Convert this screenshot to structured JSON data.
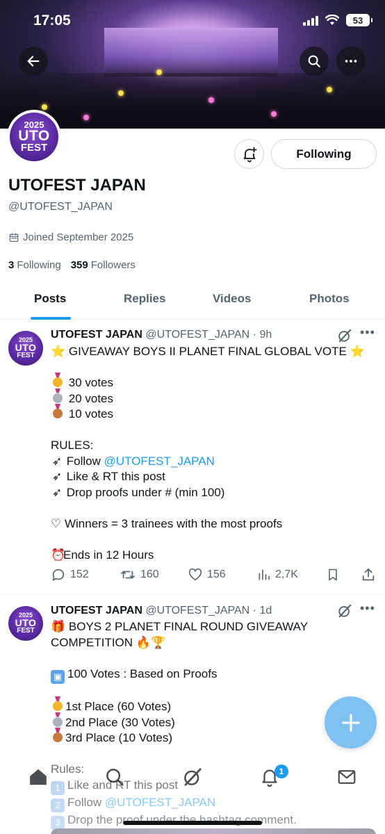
{
  "status_bar": {
    "time": "17:05",
    "battery": "53"
  },
  "profile": {
    "avatar_text": {
      "year": "2025",
      "line1": "UTO",
      "line2": "FEST"
    },
    "following_button": "Following",
    "display_name": "UTOFEST JAPAN",
    "handle": "@UTOFEST_JAPAN",
    "joined": "Joined September 2025",
    "following_count": "3",
    "following_label": "Following",
    "followers_count": "359",
    "followers_label": "Followers"
  },
  "tabs": [
    "Posts",
    "Replies",
    "Videos",
    "Photos"
  ],
  "posts": [
    {
      "name": "UTOFEST JAPAN",
      "handle_time": "@UTOFEST_JAPAN · 9h",
      "title": "GIVEAWAY BOYS II PLANET FINAL GLOBAL VOTE",
      "prizes": [
        "30 votes",
        "20 votes",
        "10 votes"
      ],
      "rules_heading": "RULES:",
      "rule1_prefix": "Follow ",
      "rule1_link": "@UTOFEST_JAPAN",
      "rule2": "Like & RT this post",
      "rule3": "Drop proofs under # (min 100)",
      "winners": "♡ Winners = 3 trainees with the most proofs",
      "ends": "Ends in 12 Hours",
      "stats": {
        "replies": "152",
        "reposts": "160",
        "likes": "156",
        "views": "2,7K"
      }
    },
    {
      "name": "UTOFEST JAPAN",
      "handle_time": "@UTOFEST_JAPAN · 1d",
      "title_line1": "BOYS 2 PLANET FINAL ROUND GIVEAWAY",
      "title_line2": "COMPETITION",
      "votes_line": "100 Votes : Based on Proofs",
      "places": [
        "1st Place (60 Votes)",
        "2nd Place (30 Votes)",
        "3rd Place (10 Votes)"
      ],
      "rules_heading": "Rules:",
      "rule1": "Like and RT this post",
      "rule2_prefix": "Follow ",
      "rule2_link": "@UTOFEST_JAPAN",
      "rule3": "Drop the proof under the hashtag comment."
    }
  ],
  "notifications_badge": "1",
  "icons": [
    "back-arrow-icon",
    "search-icon",
    "more-icon",
    "bell-plus-icon",
    "calendar-icon",
    "grok-icon",
    "reply-icon",
    "repost-icon",
    "heart-icon",
    "views-icon",
    "bookmark-icon",
    "share-icon",
    "plus-icon",
    "home-icon",
    "notifications-icon",
    "mail-icon"
  ],
  "colors": {
    "accent": "#1d9bf0",
    "fab": "#7fc1f2",
    "text": "#0f1419",
    "muted": "#536471"
  }
}
